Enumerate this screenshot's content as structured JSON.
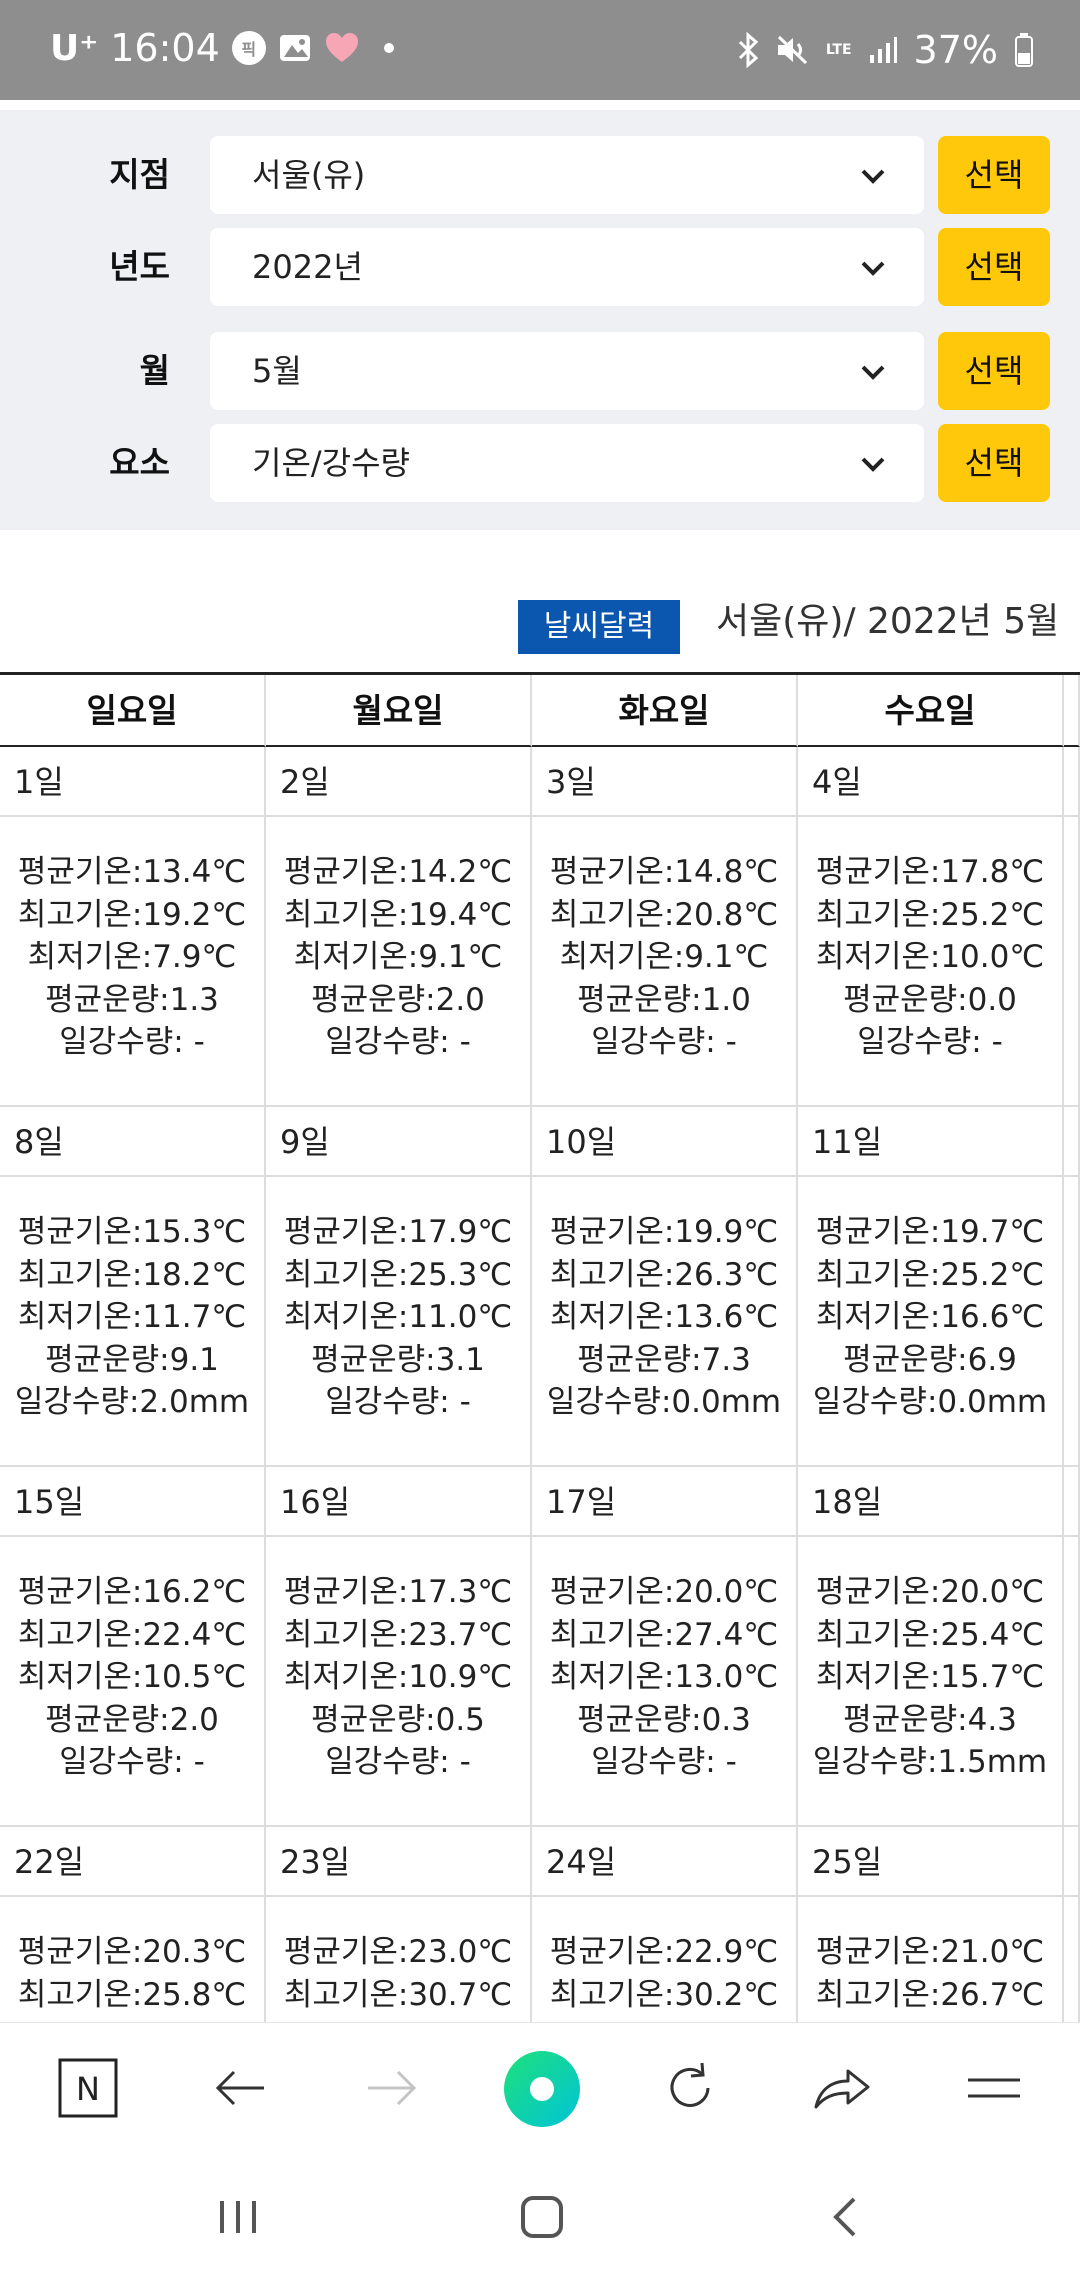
{
  "status_bar": {
    "carrier": "U⁺",
    "time": "16:04",
    "badge": "픽",
    "battery": "37%",
    "lte": "LTE",
    "icons": [
      "image-icon",
      "heart-icon",
      "dot-icon",
      "bluetooth-icon",
      "mute-icon",
      "lte-icon",
      "signal-icon",
      "battery-icon"
    ]
  },
  "filters": [
    {
      "label": "지점",
      "value": "서울(유)",
      "button": "선택"
    },
    {
      "label": "년도",
      "value": "2022년",
      "button": "선택"
    },
    {
      "label": "월",
      "value": "5월",
      "button": "선택"
    },
    {
      "label": "요소",
      "value": "기온/강수량",
      "button": "선택"
    }
  ],
  "calendar_header": {
    "badge": "날씨달력",
    "title": "서울(유)/ 2022년 5월"
  },
  "weekdays": [
    "일요일",
    "월요일",
    "화요일",
    "수요일"
  ],
  "weeks": [
    {
      "days": [
        {
          "date": "1일",
          "lines": [
            "평균기온:13.4℃",
            "최고기온:19.2℃",
            "최저기온:7.9℃",
            "평균운량:1.3",
            "일강수량: -"
          ]
        },
        {
          "date": "2일",
          "lines": [
            "평균기온:14.2℃",
            "최고기온:19.4℃",
            "최저기온:9.1℃",
            "평균운량:2.0",
            "일강수량: -"
          ]
        },
        {
          "date": "3일",
          "lines": [
            "평균기온:14.8℃",
            "최고기온:20.8℃",
            "최저기온:9.1℃",
            "평균운량:1.0",
            "일강수량: -"
          ]
        },
        {
          "date": "4일",
          "lines": [
            "평균기온:17.8℃",
            "최고기온:25.2℃",
            "최저기온:10.0℃",
            "평균운량:0.0",
            "일강수량: -"
          ]
        }
      ]
    },
    {
      "days": [
        {
          "date": "8일",
          "lines": [
            "평균기온:15.3℃",
            "최고기온:18.2℃",
            "최저기온:11.7℃",
            "평균운량:9.1",
            "일강수량:2.0mm"
          ]
        },
        {
          "date": "9일",
          "lines": [
            "평균기온:17.9℃",
            "최고기온:25.3℃",
            "최저기온:11.0℃",
            "평균운량:3.1",
            "일강수량: -"
          ]
        },
        {
          "date": "10일",
          "lines": [
            "평균기온:19.9℃",
            "최고기온:26.3℃",
            "최저기온:13.6℃",
            "평균운량:7.3",
            "일강수량:0.0mm"
          ]
        },
        {
          "date": "11일",
          "lines": [
            "평균기온:19.7℃",
            "최고기온:25.2℃",
            "최저기온:16.6℃",
            "평균운량:6.9",
            "일강수량:0.0mm"
          ]
        }
      ]
    },
    {
      "days": [
        {
          "date": "15일",
          "lines": [
            "평균기온:16.2℃",
            "최고기온:22.4℃",
            "최저기온:10.5℃",
            "평균운량:2.0",
            "일강수량: -"
          ]
        },
        {
          "date": "16일",
          "lines": [
            "평균기온:17.3℃",
            "최고기온:23.7℃",
            "최저기온:10.9℃",
            "평균운량:0.5",
            "일강수량: -"
          ]
        },
        {
          "date": "17일",
          "lines": [
            "평균기온:20.0℃",
            "최고기온:27.4℃",
            "최저기온:13.0℃",
            "평균운량:0.3",
            "일강수량: -"
          ]
        },
        {
          "date": "18일",
          "lines": [
            "평균기온:20.0℃",
            "최고기온:25.4℃",
            "최저기온:15.7℃",
            "평균운량:4.3",
            "일강수량:1.5mm"
          ]
        }
      ]
    },
    {
      "days": [
        {
          "date": "22일",
          "lines": [
            "평균기온:20.3℃",
            "최고기온:25.8℃"
          ]
        },
        {
          "date": "23일",
          "lines": [
            "평균기온:23.0℃",
            "최고기온:30.7℃"
          ]
        },
        {
          "date": "24일",
          "lines": [
            "평균기온:22.9℃",
            "최고기온:30.2℃"
          ]
        },
        {
          "date": "25일",
          "lines": [
            "평균기온:21.0℃",
            "최고기온:26.7℃"
          ]
        }
      ]
    }
  ],
  "toolbar": {
    "items": [
      "naver-n-icon",
      "back-arrow-icon",
      "forward-arrow-icon",
      "home-green-icon",
      "refresh-icon",
      "share-icon",
      "menu-icon"
    ],
    "n_label": "N"
  },
  "navbar": {
    "items": [
      "recent-apps-icon",
      "home-icon",
      "back-icon"
    ]
  },
  "colors": {
    "accent_button": "#ffc80a",
    "badge_blue": "#0b57b0",
    "panel_bg": "#eef0f4",
    "status_bar": "#8e8e8e"
  }
}
